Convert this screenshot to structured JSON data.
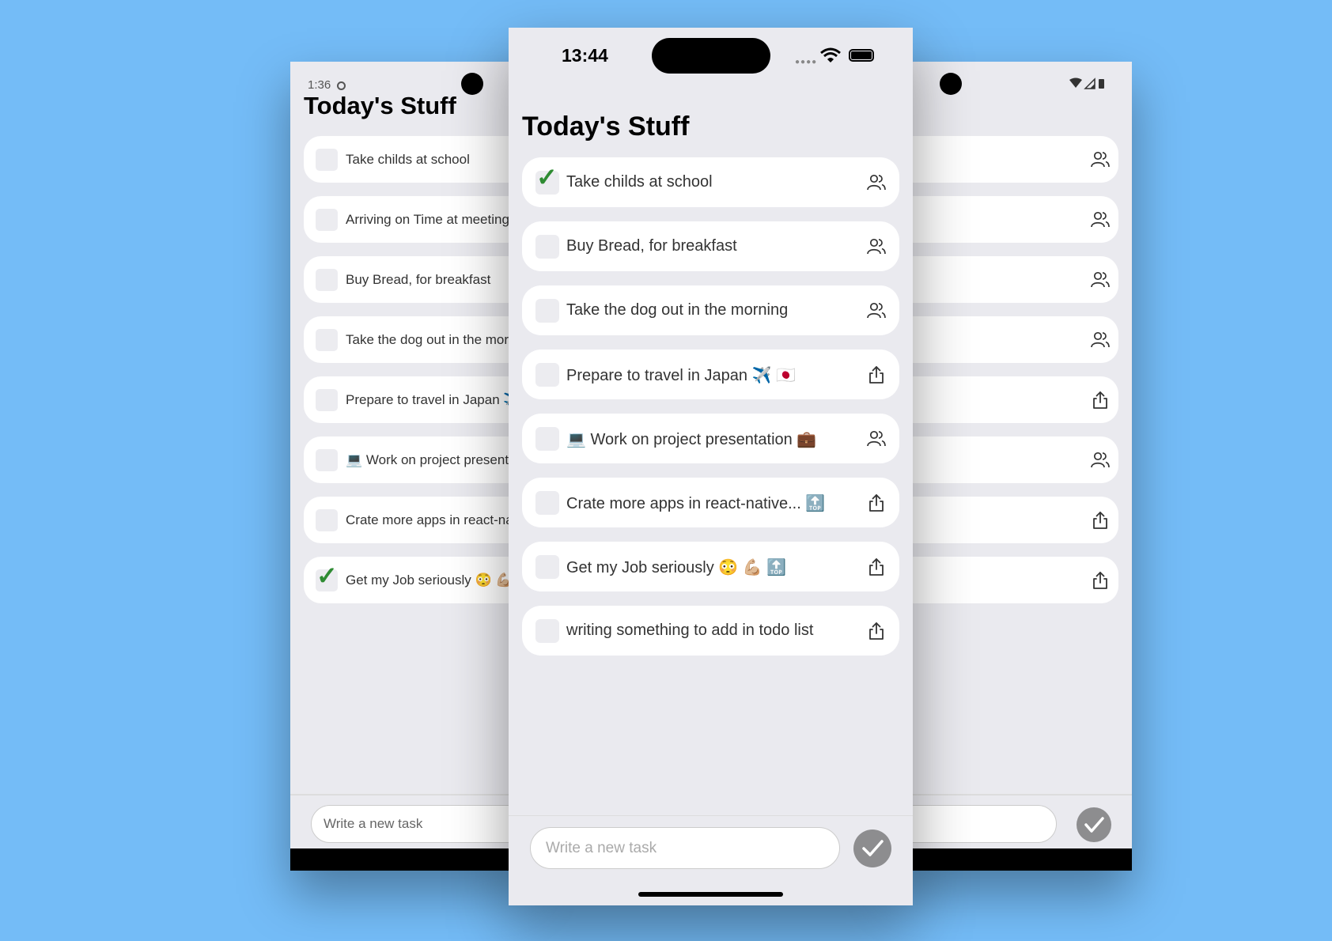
{
  "colors": {
    "background": "#74bcf7",
    "screen": "#eaeaef",
    "card": "#ffffff",
    "checkmark": "#2e8b32",
    "send_button": "#8d8d8f"
  },
  "android": {
    "status_time": "1:36",
    "title": "Today's Stuff",
    "tasks": [
      {
        "text": "Take childs at school",
        "done": false,
        "icon": "people-icon"
      },
      {
        "text": "Arriving on Time at meeting room",
        "done": false,
        "icon": "people-icon"
      },
      {
        "text": "Buy Bread, for breakfast",
        "done": false,
        "icon": "people-icon"
      },
      {
        "text": "Take the dog out in the morning",
        "done": false,
        "icon": "people-icon"
      },
      {
        "text": "Prepare to travel in Japan ✈️ 🇯🇵",
        "done": false,
        "icon": "share-icon"
      },
      {
        "text": "💻 Work on project presentation 💼",
        "done": false,
        "icon": "people-icon"
      },
      {
        "text": "Crate more apps in react-native...🔝",
        "done": false,
        "icon": "share-icon"
      },
      {
        "text": "Get my Job seriously 😳 💪🏼🔝",
        "done": true,
        "icon": "share-icon"
      }
    ],
    "input_placeholder": "Write a new task"
  },
  "ios": {
    "status_time": "13:44",
    "title": "Today's Stuff",
    "tasks": [
      {
        "text": "Take childs at school",
        "done": true,
        "icon": "people-icon"
      },
      {
        "text": "Buy Bread, for breakfast",
        "done": false,
        "icon": "people-icon"
      },
      {
        "text": "Take the dog out in the morning",
        "done": false,
        "icon": "people-icon"
      },
      {
        "text": "Prepare to travel in Japan ✈️ 🇯🇵",
        "done": false,
        "icon": "share-icon"
      },
      {
        "text": "💻 Work on project presentation 💼",
        "done": false,
        "icon": "people-icon"
      },
      {
        "text": "Crate more apps in react-native... 🔝",
        "done": false,
        "icon": "share-icon"
      },
      {
        "text": "Get my Job seriously 😳 💪🏼 🔝",
        "done": false,
        "icon": "share-icon"
      },
      {
        "text": "writing something to add in todo list",
        "done": false,
        "icon": "share-icon"
      }
    ],
    "input_placeholder": "Write a new task"
  },
  "check_glyph": "✓"
}
